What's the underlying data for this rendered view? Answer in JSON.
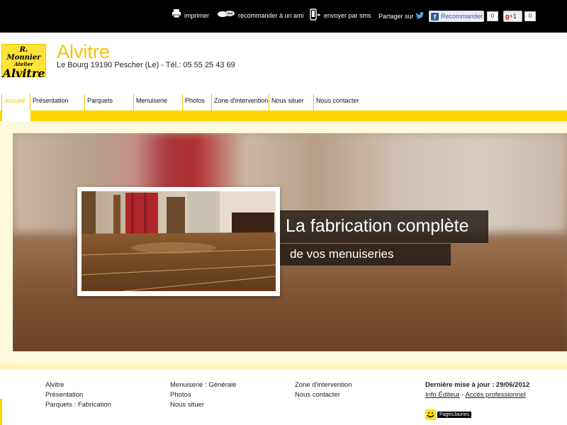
{
  "topbar": {
    "print_label": "imprimer",
    "recommend_label": "recommander à un ami",
    "sms_label": "envoyer par sms",
    "share_label": "Partager sur",
    "fb_label": "Recommander",
    "fb_count": "0",
    "gplus_label": "+1",
    "gplus_count": "0"
  },
  "header": {
    "logo_line1": "R. Monnier",
    "logo_line2": "Atelier",
    "logo_line3": "Alvitre",
    "title": "Alvitre",
    "subtitle": "Le Bourg 19190 Pescher (Le) - Tél.: 05 55 25 43 69"
  },
  "nav": {
    "items": [
      {
        "label": "Accueil",
        "active": true
      },
      {
        "label": "Présentation"
      },
      {
        "label": "Parquets"
      },
      {
        "label": "Menuiserie"
      },
      {
        "label": "Photos"
      },
      {
        "label": "Zone d'intervention"
      },
      {
        "label": "Nous situer"
      },
      {
        "label": "Nous contacter"
      }
    ]
  },
  "banner": {
    "caption_line1": "La fabrication complète",
    "caption_line2": "de vos menuiseries"
  },
  "footer": {
    "col1": [
      "Alvitre",
      "Présentation",
      "Parquets : Fabrication"
    ],
    "col2": [
      "Menuiserie : Générale",
      "Photos",
      "Nous situer"
    ],
    "col3": [
      "Zone d'intervention",
      "Nous contacter"
    ],
    "update": "Dernière mise à jour : 29/06/2012",
    "info_editor": "Info Éditeur",
    "separator": "-",
    "pro_access": "Accès professionnel",
    "pagesjaunes": "PagesJaunes"
  },
  "colors": {
    "accent": "#f5c400",
    "band": "#ffd500",
    "cream": "#fff9dc"
  }
}
